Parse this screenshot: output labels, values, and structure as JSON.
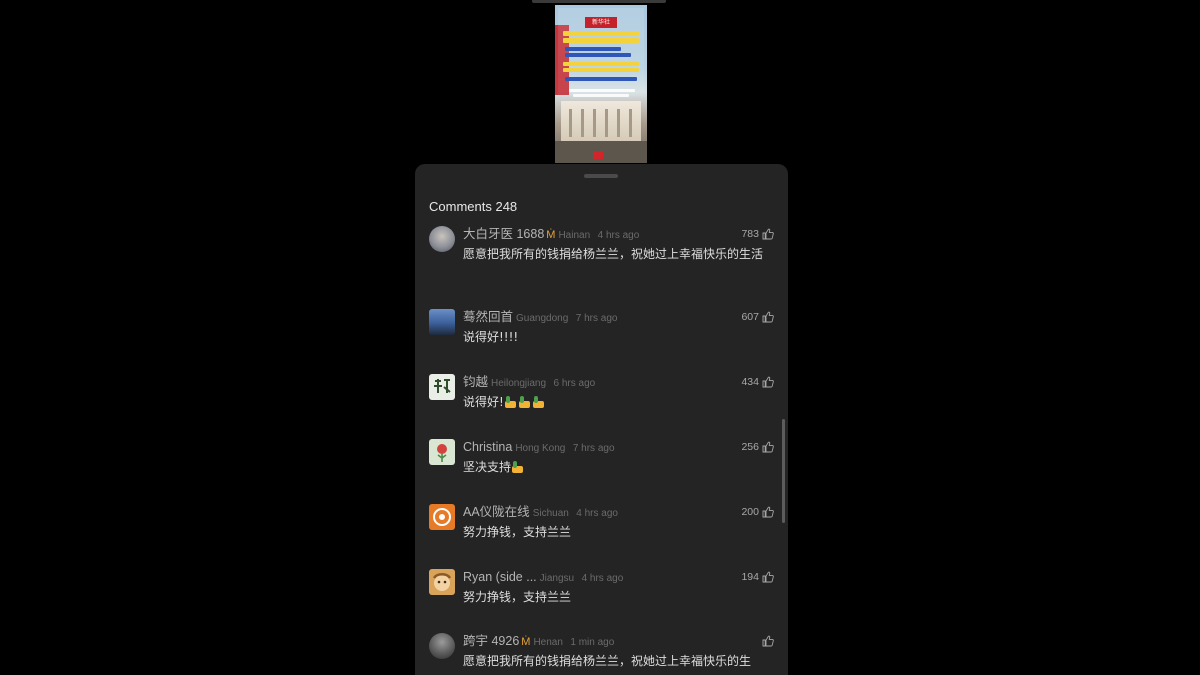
{
  "thumbnail": {
    "headline_chip": "新华社"
  },
  "comments_panel": {
    "title": "Comments 248"
  },
  "comments": [
    {
      "author": "大白牙医 1688",
      "badge": "Ṁ",
      "location": "Hainan",
      "time": "4 hrs ago",
      "likes": "783",
      "text": "愿意把我所有的钱捐给杨兰兰，祝她过上幸福快乐的生活",
      "avatar_color": "#8c8f98"
    },
    {
      "author": "蓦然回首",
      "badge": "",
      "location": "Guangdong",
      "time": "7 hrs ago",
      "likes": "607",
      "text": "说得好!!!!",
      "avatar_color": "#3a5f9a"
    },
    {
      "author": "钧越",
      "badge": "",
      "location": "Heilongjiang",
      "time": "6 hrs ago",
      "likes": "434",
      "text": "说得好!",
      "emoji_count": 3,
      "avatar_color": "#e9efe6"
    },
    {
      "author": "Christina",
      "badge": "",
      "location": "Hong Kong",
      "time": "7 hrs ago",
      "likes": "256",
      "text": "坚决支持",
      "emoji_count": 1,
      "avatar_color": "#d8e6d2"
    },
    {
      "author": "AA仪陇在线",
      "badge": "",
      "location": "Sichuan",
      "time": "4 hrs ago",
      "likes": "200",
      "text": "努力挣钱，支持兰兰",
      "avatar_color": "#e77a26"
    },
    {
      "author": "Ryan (side ...",
      "badge": "",
      "location": "Jiangsu",
      "time": "4 hrs ago",
      "likes": "194",
      "text": "努力挣钱，支持兰兰",
      "avatar_color": "#d9a35a"
    },
    {
      "author": "跨宇 4926",
      "badge": "Ṁ",
      "location": "Henan",
      "time": "1 min ago",
      "likes": "",
      "text": "愿意把我所有的钱捐给杨兰兰，祝她过上幸福快乐的生",
      "avatar_color": "#5b5b5b"
    }
  ],
  "icons": {
    "like": "thumbs-up-icon"
  }
}
